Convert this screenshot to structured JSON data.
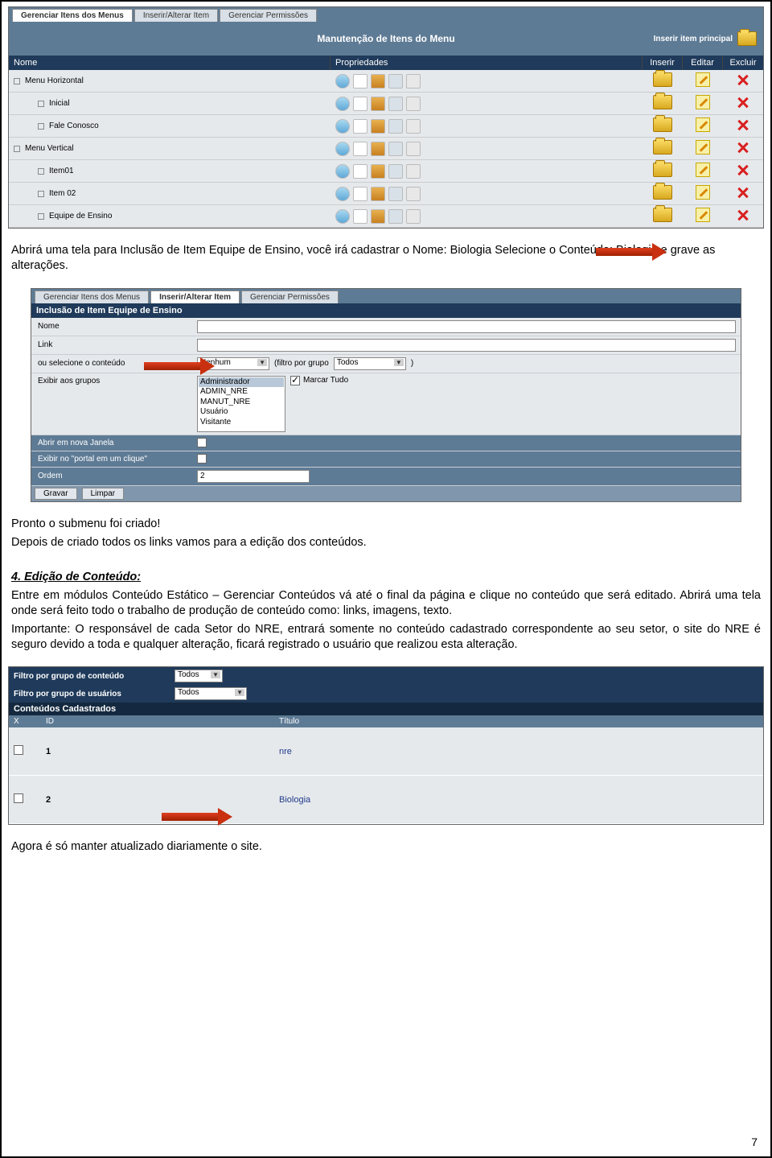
{
  "tabs": [
    "Gerenciar Itens dos Menus",
    "Inserir/Alterar Item",
    "Gerenciar Permissões"
  ],
  "title_bar": "Manutenção de Itens do Menu",
  "insert_principal": "Inserir item principal",
  "cols": {
    "nome": "Nome",
    "prop": "Propriedades",
    "inserir": "Inserir",
    "editar": "Editar",
    "excluir": "Excluir"
  },
  "menu_rows": [
    {
      "label": "Menu Horizontal",
      "indent": 0
    },
    {
      "label": "Inicial",
      "indent": 1
    },
    {
      "label": "Fale Conosco",
      "indent": 1
    },
    {
      "label": "Menu Vertical",
      "indent": 0
    },
    {
      "label": "Item01",
      "indent": 1
    },
    {
      "label": "Item 02",
      "indent": 1
    },
    {
      "label": "Equipe de Ensino",
      "indent": 1
    }
  ],
  "body1": "Abrirá uma tela para Inclusão de Item Equipe de Ensino, você irá cadastrar o Nome: Biologia Selecione o Conteúdo: Biologia e grave as alterações.",
  "ss2": {
    "active_tab": "Inserir/Alterar Item",
    "form_title": "Inclusão de Item Equipe de Ensino",
    "rows": {
      "nome": "Nome",
      "link": "Link",
      "ou_sel": "ou selecione o conteúdo",
      "nenhum": "Nenhum",
      "filtro": "(filtro por grupo",
      "todos": "Todos",
      "paren": ")",
      "exibir_grupos": "Exibir aos grupos",
      "grupos": [
        "Administrador",
        "ADMIN_NRE",
        "MANUT_NRE",
        "Usuário",
        "Visitante"
      ],
      "marcar_tudo": "Marcar Tudo",
      "abrir_janela": "Abrir em nova Janela",
      "exibir_portal": "Exibir no \"portal em um clique\"",
      "ordem": "Ordem",
      "ordem_val": "2"
    },
    "buttons": {
      "gravar": "Gravar",
      "limpar": "Limpar"
    }
  },
  "body2a": "Pronto o submenu foi criado!",
  "body2b": "Depois de criado todos os links vamos para a edição dos conteúdos.",
  "section4_title": "4. Edição de Conteúdo:",
  "body3a": "Entre em módulos Conteúdo Estático – Gerenciar Conteúdos vá até o final da página e clique no conteúdo que será editado. Abrirá uma tela onde será feito todo o trabalho de produção de conteúdo como: links, imagens, texto.",
  "body3b": "Importante: O responsável de cada Setor do NRE, entrará somente no conteúdo cadastrado correspondente ao seu setor, o site do NRE é seguro devido a toda e qualquer alteração, ficará registrado o usuário que realizou esta alteração.",
  "ss3": {
    "filter1_label": "Filtro por grupo de conteúdo",
    "filter1_val": "Todos",
    "filter2_label": "Filtro por grupo de usuários",
    "filter2_val": "Todos",
    "header": "Conteúdos Cadastrados",
    "cols": {
      "x": "X",
      "id": "ID",
      "titulo": "Título"
    },
    "rows": [
      {
        "id": "1",
        "titulo": "nre"
      },
      {
        "id": "2",
        "titulo": "Biologia"
      }
    ]
  },
  "body4": "Agora é só manter atualizado diariamente o site.",
  "page_number": "7"
}
